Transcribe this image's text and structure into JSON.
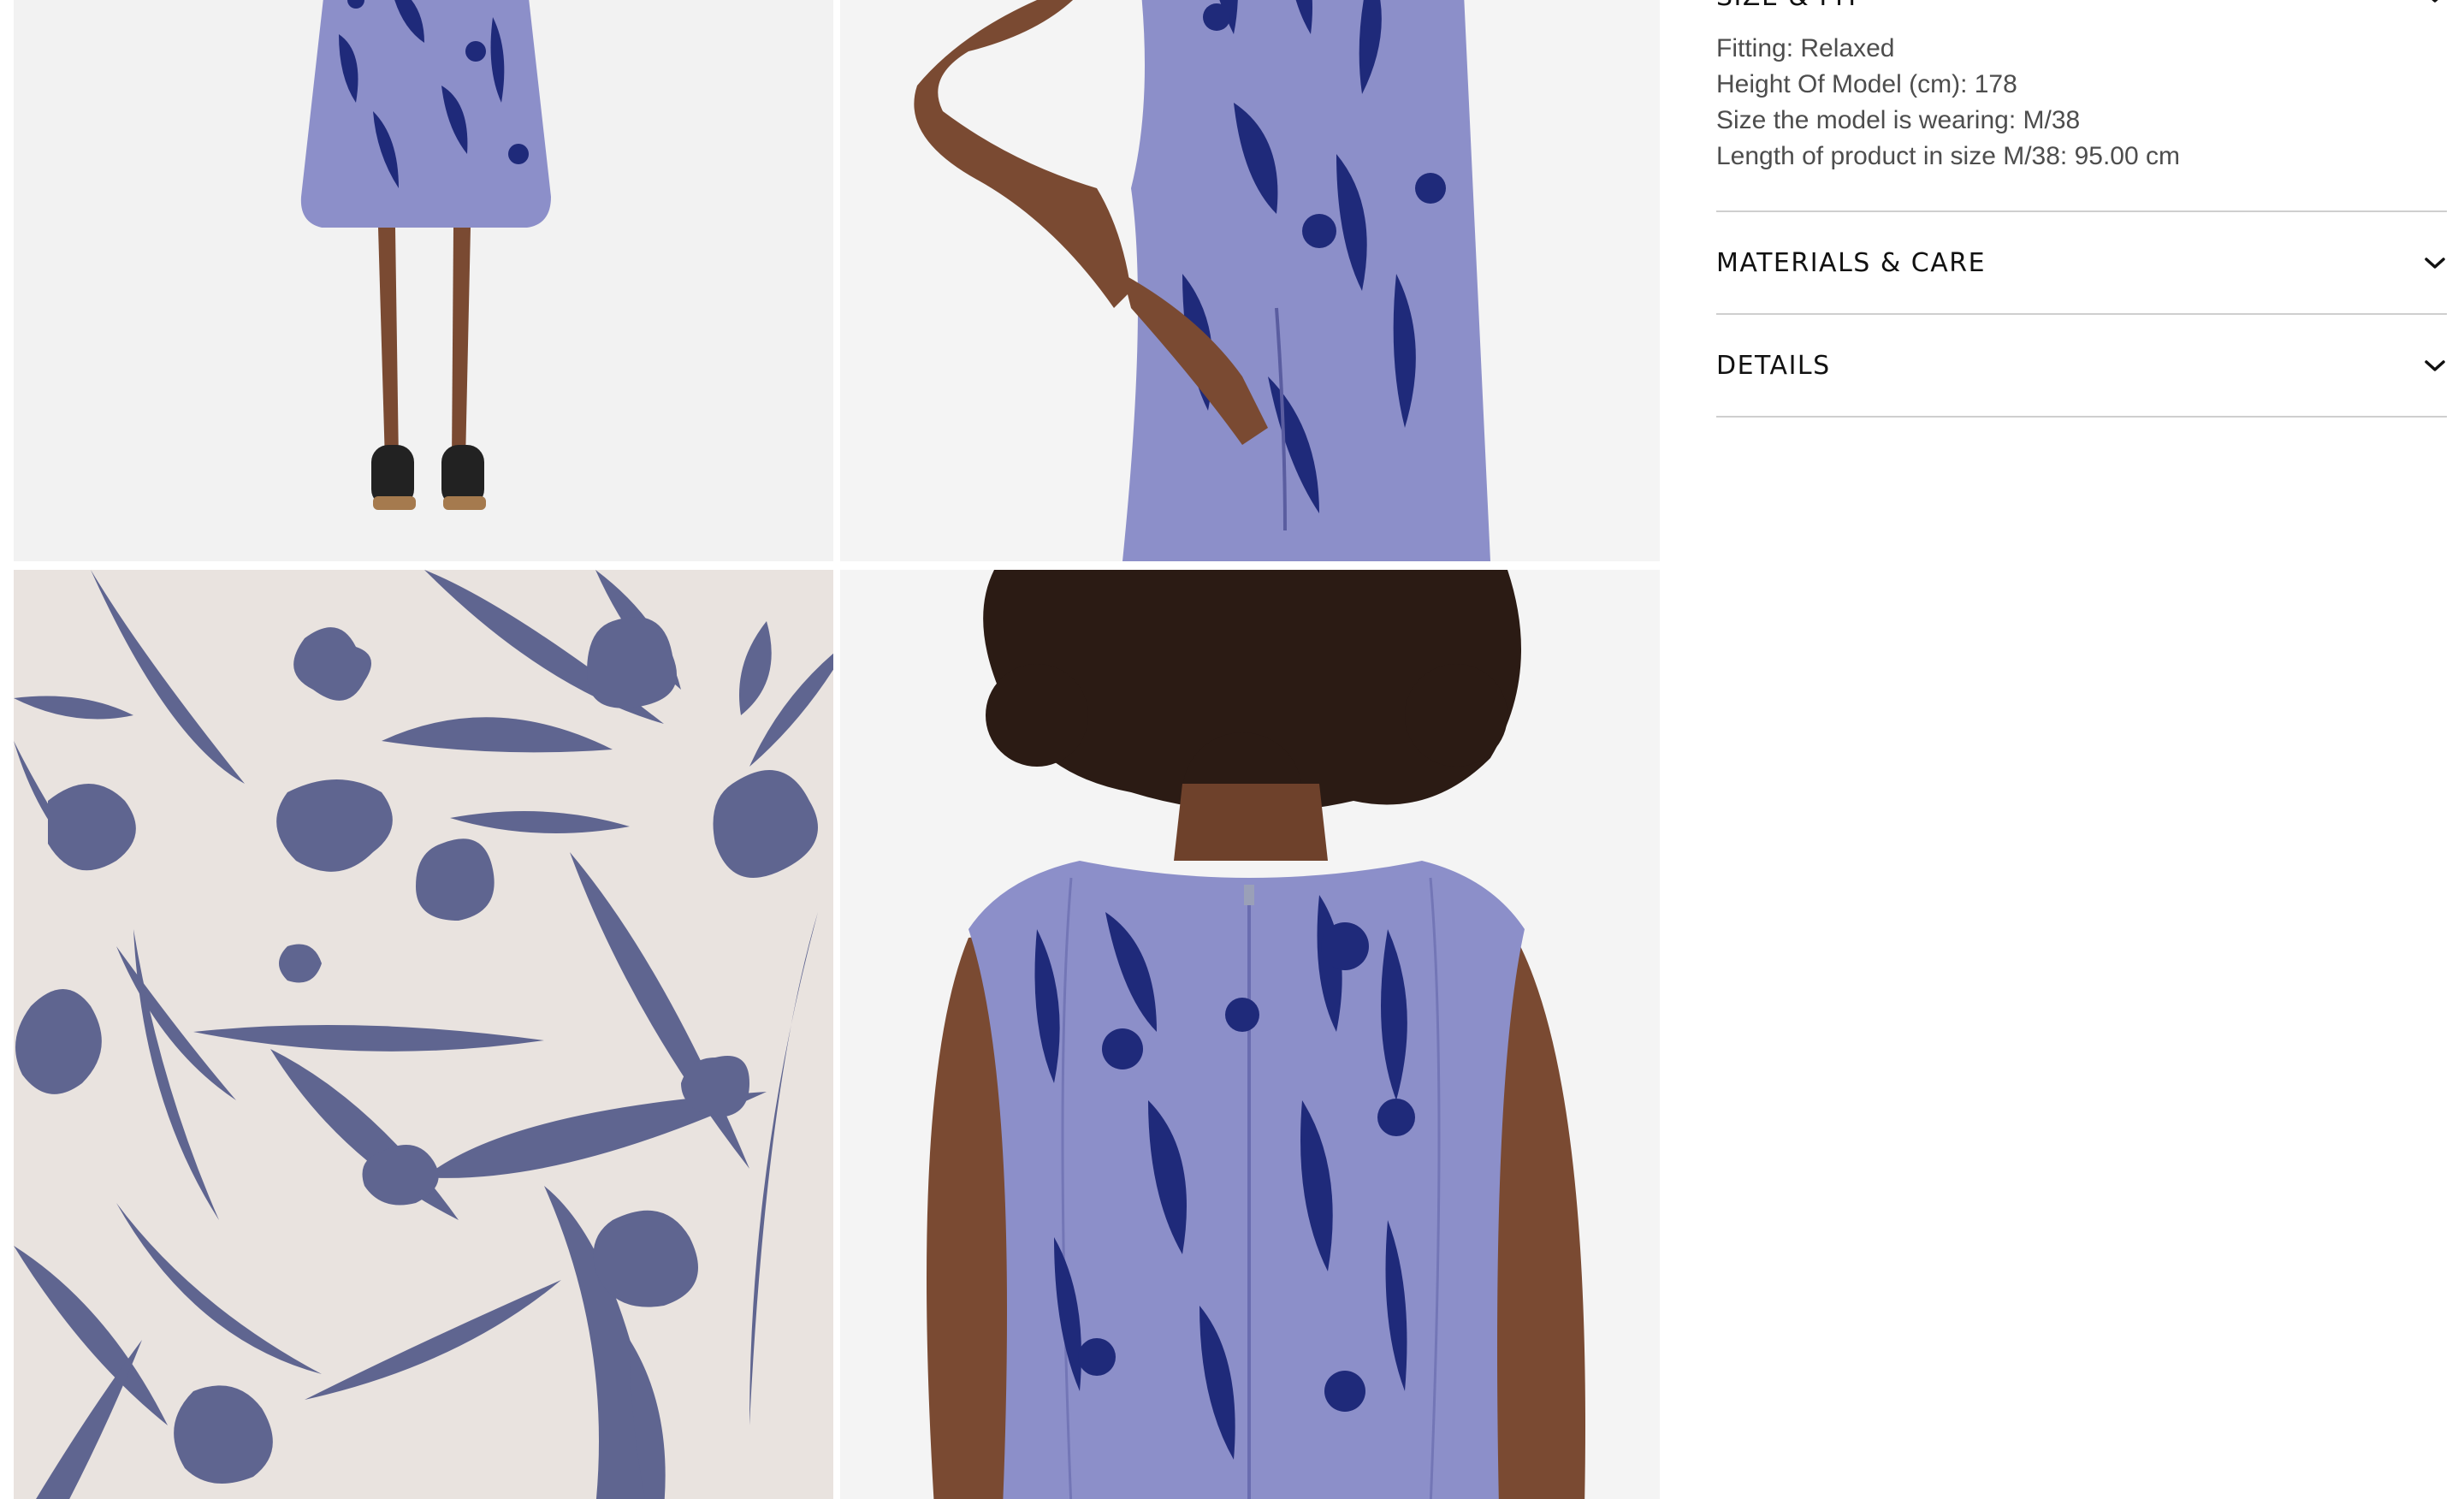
{
  "gallery": {
    "images": [
      {
        "name": "dress-back-full-length",
        "alt": ""
      },
      {
        "name": "dress-side-pocket",
        "alt": ""
      },
      {
        "name": "print-pattern-swatch",
        "alt": ""
      },
      {
        "name": "dress-back-upper",
        "alt": ""
      }
    ],
    "colors": {
      "dress_base": "#8c8fc9",
      "dress_print": "#1f2a7a",
      "swatch_bg": "#e9e3df",
      "swatch_print": "#5f6590",
      "skin": "#7a4a32",
      "bg": "#f2f2f2"
    }
  },
  "size_fit": {
    "title": "SIZE & FIT",
    "lines": [
      "Fitting: Relaxed",
      "Height Of Model (cm): 178",
      "Size the model is wearing: M/38",
      "Length of product in size M/38: 95.00 cm"
    ]
  },
  "materials_care": {
    "title": "MATERIALS & CARE"
  },
  "details": {
    "title": "DETAILS"
  },
  "icons": {
    "chevron": "chevron-down-icon"
  }
}
